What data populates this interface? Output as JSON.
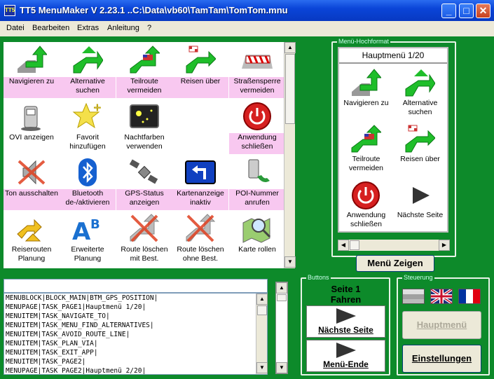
{
  "window": {
    "title": "TT5 MenuMaker V 2.23.1 ..C:\\Data\\vb60\\TamTam\\TomTom.mnu",
    "app_icon": "TT5"
  },
  "menubar": [
    "Datei",
    "Bearbeiten",
    "Extras",
    "Anleitung",
    "?"
  ],
  "grid": [
    {
      "label": "Navigieren zu",
      "icon": "navigate-arrow-icon",
      "pink": true
    },
    {
      "label": "Alternative suchen",
      "icon": "alternative-route-icon",
      "pink": true
    },
    {
      "label": "Teilroute vermeiden",
      "icon": "avoid-part-route-icon",
      "pink": true
    },
    {
      "label": "Reisen über",
      "icon": "travel-via-icon",
      "pink": true
    },
    {
      "label": "Straßensperre vermeiden",
      "icon": "roadblock-icon",
      "pink": true
    },
    {
      "label": "OVI anzeigen",
      "icon": "poi-pump-icon",
      "pink": false
    },
    {
      "label": "Favorit hinzufügen",
      "icon": "add-favorite-star-icon",
      "pink": false
    },
    {
      "label": "Nachtfarben verwenden",
      "icon": "night-colors-icon",
      "pink": false
    },
    {
      "label": "",
      "icon": "",
      "pink": false
    },
    {
      "label": "Anwendung schließen",
      "icon": "power-icon",
      "pink": true
    },
    {
      "label": "Ton ausschalten",
      "icon": "speaker-muted-icon",
      "pink": true
    },
    {
      "label": "Bluetooth de-/aktivieren",
      "icon": "bluetooth-icon",
      "pink": true
    },
    {
      "label": "GPS-Status anzeigen",
      "icon": "satellite-icon",
      "pink": true
    },
    {
      "label": "Kartenanzeige inaktiv",
      "icon": "turn-left-sign-icon",
      "pink": true
    },
    {
      "label": "POI-Nummer anrufen",
      "icon": "phone-poi-icon",
      "pink": true
    },
    {
      "label": "Reiserouten Planung",
      "icon": "route-planning-icon",
      "pink": false
    },
    {
      "label": "Erweiterte Planung",
      "icon": "advanced-planning-icon",
      "pink": false
    },
    {
      "label": "Route löschen mit Best.",
      "icon": "delete-route-confirm-icon",
      "pink": false
    },
    {
      "label": "Route löschen ohne Best.",
      "icon": "delete-route-icon",
      "pink": false
    },
    {
      "label": "Karte rollen",
      "icon": "map-magnifier-icon",
      "pink": false
    }
  ],
  "preview": {
    "legend": "Menü-Hochformat",
    "title": "Hauptmenü 1/20",
    "items": [
      {
        "label": "Navigieren zu",
        "icon": "navigate-arrow-icon"
      },
      {
        "label": "Alternative suchen",
        "icon": "alternative-route-icon"
      },
      {
        "label": "Teilroute vermeiden",
        "icon": "avoid-part-route-icon"
      },
      {
        "label": "Reisen über",
        "icon": "travel-via-icon"
      },
      {
        "label": "Anwendung schließen",
        "icon": "power-icon"
      },
      {
        "label": "Nächste Seite",
        "icon": "next-page-arrow-icon"
      }
    ]
  },
  "show_menu_button": "Menü Zeigen",
  "code_lines": [
    "MENUBLOCK|BLOCK_MAIN|BTM_GPS_POSITION|",
    "MENUPAGE|TASK_PAGE1|Hauptmenü 1/20|",
    "MENUITEM|TASK_NAVIGATE_TO|",
    "MENUITEM|TASK_MENU_FIND_ALTERNATIVES|",
    "MENUITEM|TASK_AVOID_ROUTE_LINE|",
    "MENUITEM|TASK_PLAN_VIA|",
    "MENUITEM|TASK_EXIT_APP|",
    "MENUITEM|TASK_PAGE2|",
    "MENUPAGE|TASK_PAGE2|Hauptmenü 2/20|"
  ],
  "buttons_group": {
    "legend": "Buttons",
    "page_line1": "Seite 1",
    "page_line2": "Fahren",
    "next_page": "Nächste Seite",
    "menu_end": "Menü-Ende"
  },
  "control_group": {
    "legend": "Steuerung",
    "main_menu": "Hauptmenü",
    "settings": "Einstellungen"
  },
  "colors": {
    "background": "#0d8a2a",
    "label_pink": "#f8c8f0",
    "titlebar": "#0a45d8"
  }
}
